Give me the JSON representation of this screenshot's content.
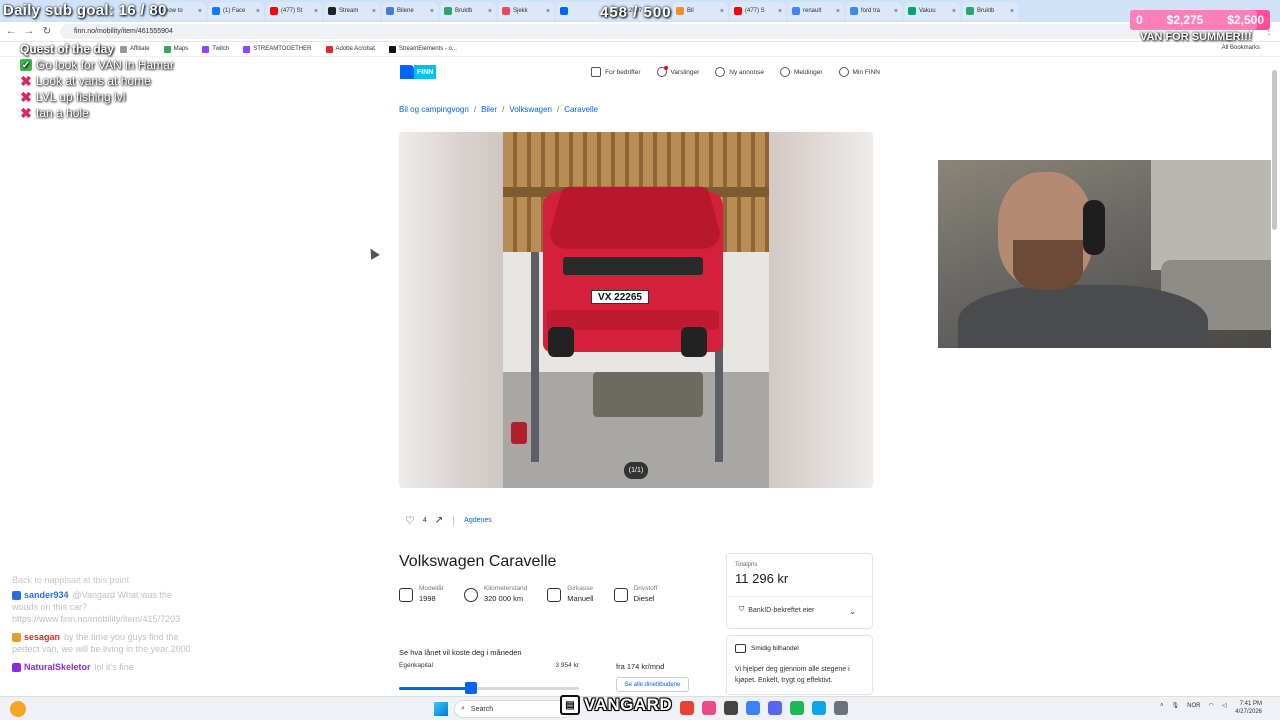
{
  "browser": {
    "tabs": [
      {
        "label": "how to",
        "color": "#4285f4"
      },
      {
        "label": "(1) Face",
        "color": "#1877f2"
      },
      {
        "label": "(477) St",
        "color": "#ff0000"
      },
      {
        "label": "Stream",
        "color": "#222222"
      },
      {
        "label": "Bilene",
        "color": "#4a7bd8"
      },
      {
        "label": "Bruktb",
        "color": "#2aa66a"
      },
      {
        "label": "Sjekk",
        "color": "#e84a5f"
      },
      {
        "label": "",
        "color": "#0063fb"
      },
      {
        "label": "2007 V",
        "color": "#5aa05a"
      },
      {
        "label": "Bil",
        "color": "#f28c28"
      },
      {
        "label": "(477) S",
        "color": "#ff0000"
      },
      {
        "label": "renault",
        "color": "#4285f4"
      },
      {
        "label": "ford tra",
        "color": "#4285f4"
      },
      {
        "label": "Vakuu",
        "color": "#00a86b"
      },
      {
        "label": "Bruktb",
        "color": "#2aa66a"
      }
    ],
    "url": "finn.no/mobility/item/461555904",
    "bookmarks": [
      {
        "label": "Affiliate",
        "color": "#999999"
      },
      {
        "label": "Maps",
        "color": "#34a853"
      },
      {
        "label": "Twitch",
        "color": "#9146ff"
      },
      {
        "label": "STREAMTOGETHER",
        "color": "#9146ff"
      },
      {
        "label": "Adobe Acrobat",
        "color": "#e3262b"
      },
      {
        "label": "StreamElements - o...",
        "color": "#111111"
      }
    ],
    "all_bookmarks": "All Bookmarks"
  },
  "overlay": {
    "subgoal": "Daily sub goal: 16 / 80",
    "counter": "458 / 500",
    "money_current": "$2,275",
    "money_goal": "$2,500",
    "money_start": "0",
    "money_progress": 0.91,
    "goal_name": "VAN FOR SUMMER!!!",
    "quest_title": "Quest of the day",
    "quests": [
      {
        "text": "Go look for VAN in Hamar",
        "done": true
      },
      {
        "text": "Look at vans at home",
        "done": false
      },
      {
        "text": "LVL up fishing lvl",
        "done": false
      },
      {
        "text": "tan a hole",
        "done": false
      }
    ],
    "chat": {
      "faded": "Back to nappisait at this point",
      "messages": [
        {
          "user": "sander934",
          "user_color": "#2b6de3",
          "badge": "#2b6de3",
          "text": "@Vangard What was the woods on this car? https://www.finn.no/mobility/item/415/7203"
        },
        {
          "user": "sesagan",
          "user_color": "#e02b2b",
          "badge": "#e0a02b",
          "text": "by the time you guys find the perfect van, we will be living in the year 2000"
        },
        {
          "user": "NaturalSkeletor",
          "user_color": "#8a2be2",
          "badge": "#8a2be2",
          "text": "lol it's fine"
        }
      ]
    },
    "streamer": "VANGARD"
  },
  "finn": {
    "logo": "FINN",
    "nav": [
      {
        "label": "For bedrifter",
        "icon": "building-icon"
      },
      {
        "label": "Varslinger",
        "icon": "bell-icon"
      },
      {
        "label": "Ny annonse",
        "icon": "plus-circle-icon"
      },
      {
        "label": "Meldinger",
        "icon": "chat-icon"
      },
      {
        "label": "Min FINN",
        "icon": "user-icon"
      }
    ],
    "breadcrumb": [
      "Bil og campingvogn",
      "Biler",
      "Volkswagen",
      "Caravelle"
    ],
    "license_plate": "VX 22265",
    "image_counter": "(1/1)",
    "likes": "4",
    "ad_link": "Agdenes",
    "title": "Volkswagen Caravelle",
    "specs": [
      {
        "label": "Modellår",
        "value": "1998",
        "icon": "calendar-icon"
      },
      {
        "label": "Kilometerstand",
        "value": "320 000 km",
        "icon": "gauge-icon"
      },
      {
        "label": "Girkasse",
        "value": "Manuell",
        "icon": "gearshift-icon"
      },
      {
        "label": "Drivstoff",
        "value": "Diesel",
        "icon": "fuel-icon"
      }
    ],
    "loan": {
      "title": "Se hva lånet vil koste deg i måneden",
      "equity_label": "Egenkapital",
      "equity_value": "3 954 kr",
      "monthly": "fra 174 kr/mnd",
      "offers_button": "Se alle dinetilbudene",
      "slider_fraction": 0.4
    },
    "price": {
      "label": "Totalpris",
      "value": "11 296 kr",
      "bankid": "BankID-bekreftet eier"
    },
    "deal": {
      "title": "Smidig bilhandel",
      "body": "Vi hjelper deg gjennom alle stegene i kjøpet. Enkelt, trygt og effektivt."
    }
  },
  "taskbar": {
    "search": "Search",
    "lang": "NOR",
    "time": "7:41 PM",
    "date": "4/27/2026"
  }
}
